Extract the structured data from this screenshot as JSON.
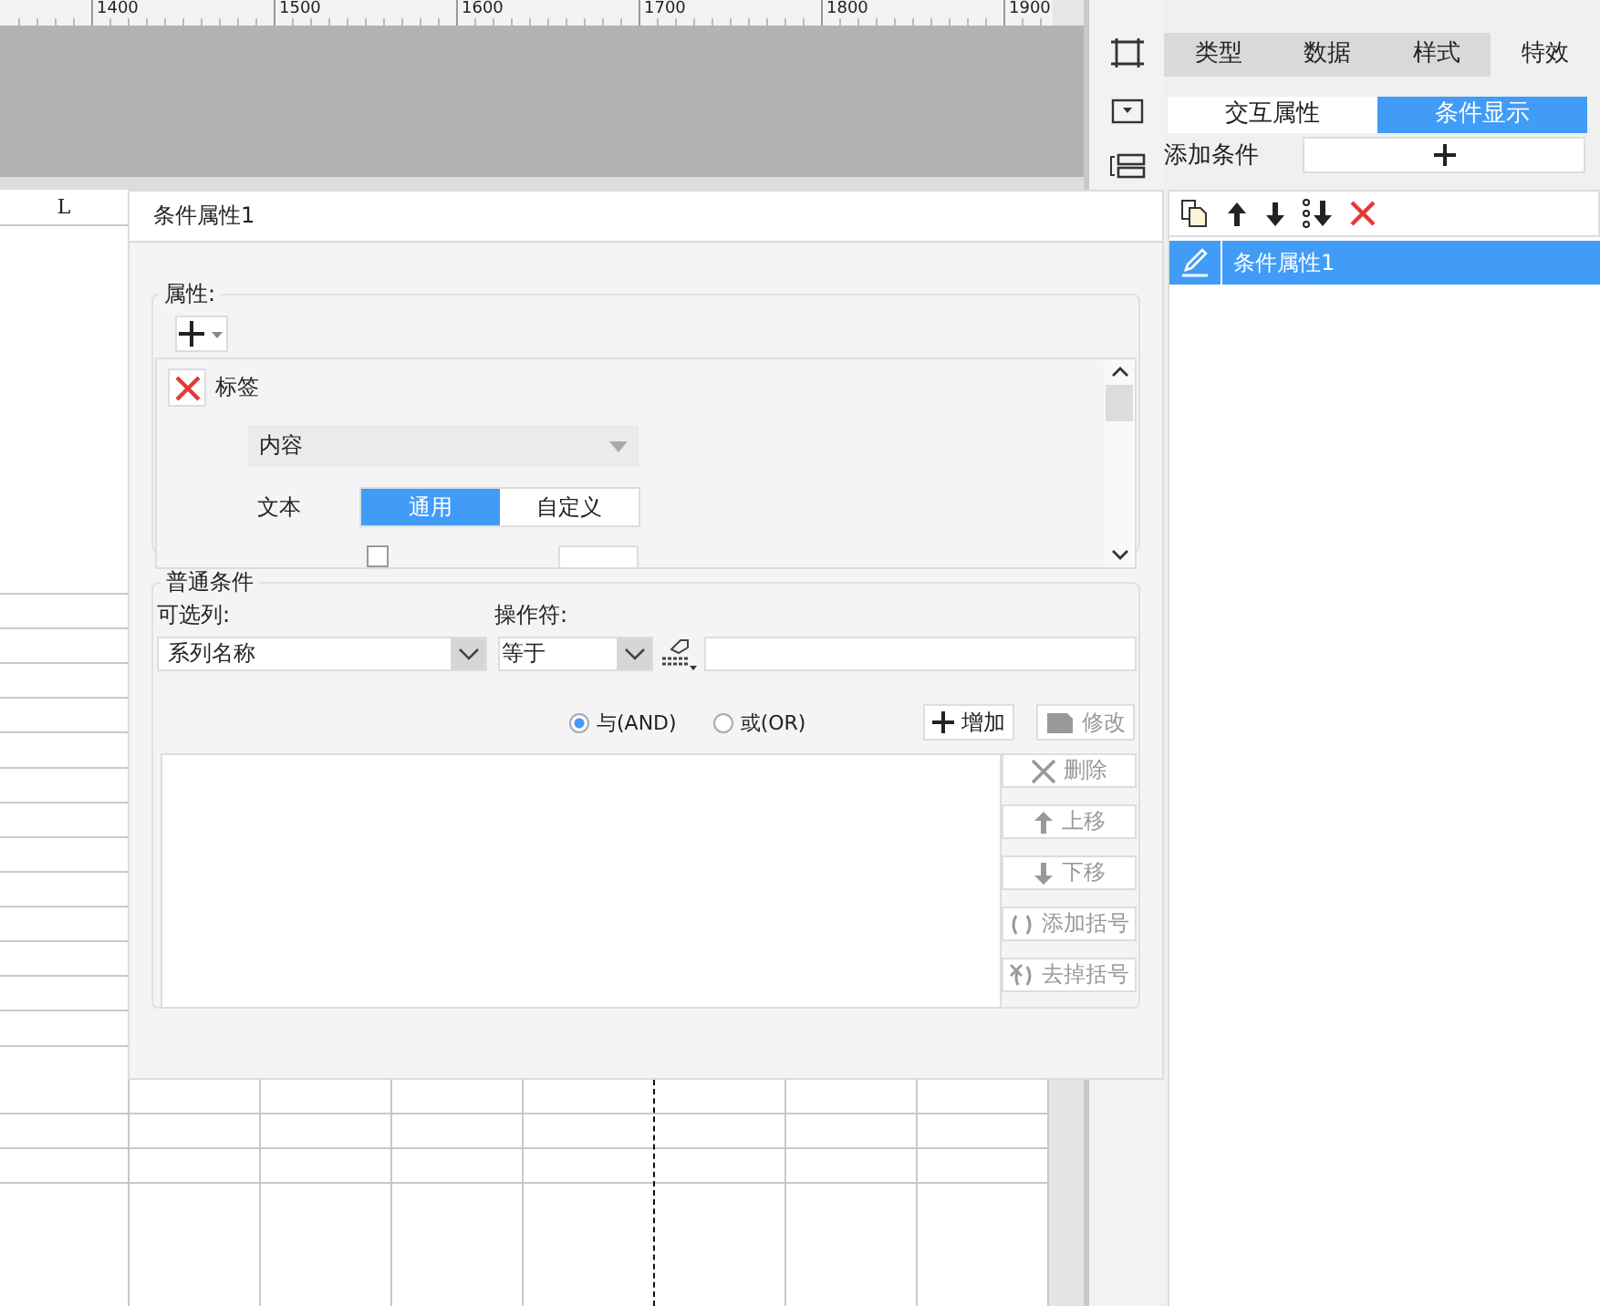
{
  "ruler": {
    "labels": [
      "1400",
      "1500",
      "1600",
      "1700",
      "1800",
      "1900"
    ]
  },
  "sheet": {
    "column_header": "L"
  },
  "toolstrip": {
    "items": [
      {
        "kind": "frame"
      },
      {
        "kind": "dropdown"
      },
      {
        "kind": "layout"
      }
    ]
  },
  "panel": {
    "tabs": [
      {
        "label": "类型",
        "selected": false
      },
      {
        "label": "数据",
        "selected": false
      },
      {
        "label": "样式",
        "selected": false
      },
      {
        "label": "特效",
        "selected": true
      }
    ],
    "subtabs": [
      {
        "label": "交互属性",
        "selected": false
      },
      {
        "label": "条件显示",
        "selected": true
      }
    ],
    "add_condition_label": "添加条件",
    "toolbar": [
      {
        "kind": "copy"
      },
      {
        "kind": "up"
      },
      {
        "kind": "down"
      },
      {
        "kind": "bottom"
      },
      {
        "kind": "delete"
      }
    ],
    "conditions": [
      {
        "label": "条件属性1",
        "selected": true
      }
    ]
  },
  "dialog": {
    "title": "条件属性1",
    "properties": {
      "legend": "属性:",
      "items": [
        {
          "name": "标签",
          "dropdown": "内容",
          "text_label": "文本",
          "modes": [
            {
              "label": "通用",
              "selected": true
            },
            {
              "label": "自定义",
              "selected": false
            }
          ],
          "checked": false
        }
      ]
    },
    "conditions": {
      "legend": "普通条件",
      "column_label": "可选列:",
      "column_value": "系列名称",
      "operator_label": "操作符:",
      "operator_value": "等于",
      "logic": [
        {
          "label": "与(AND)",
          "selected": true
        },
        {
          "label": "或(OR)",
          "selected": false
        }
      ],
      "add_button": {
        "label": "增加",
        "disabled": false
      },
      "modify_button": {
        "label": "修改",
        "disabled": true
      },
      "side_buttons": [
        {
          "kind": "delete",
          "label": "删除",
          "disabled": true
        },
        {
          "kind": "up",
          "label": "上移",
          "disabled": true
        },
        {
          "kind": "down",
          "label": "下移",
          "disabled": true
        },
        {
          "kind": "add-bracket",
          "label": "添加括号",
          "disabled": true
        },
        {
          "kind": "remove-bracket",
          "label": "去掉括号",
          "disabled": true
        }
      ]
    }
  }
}
